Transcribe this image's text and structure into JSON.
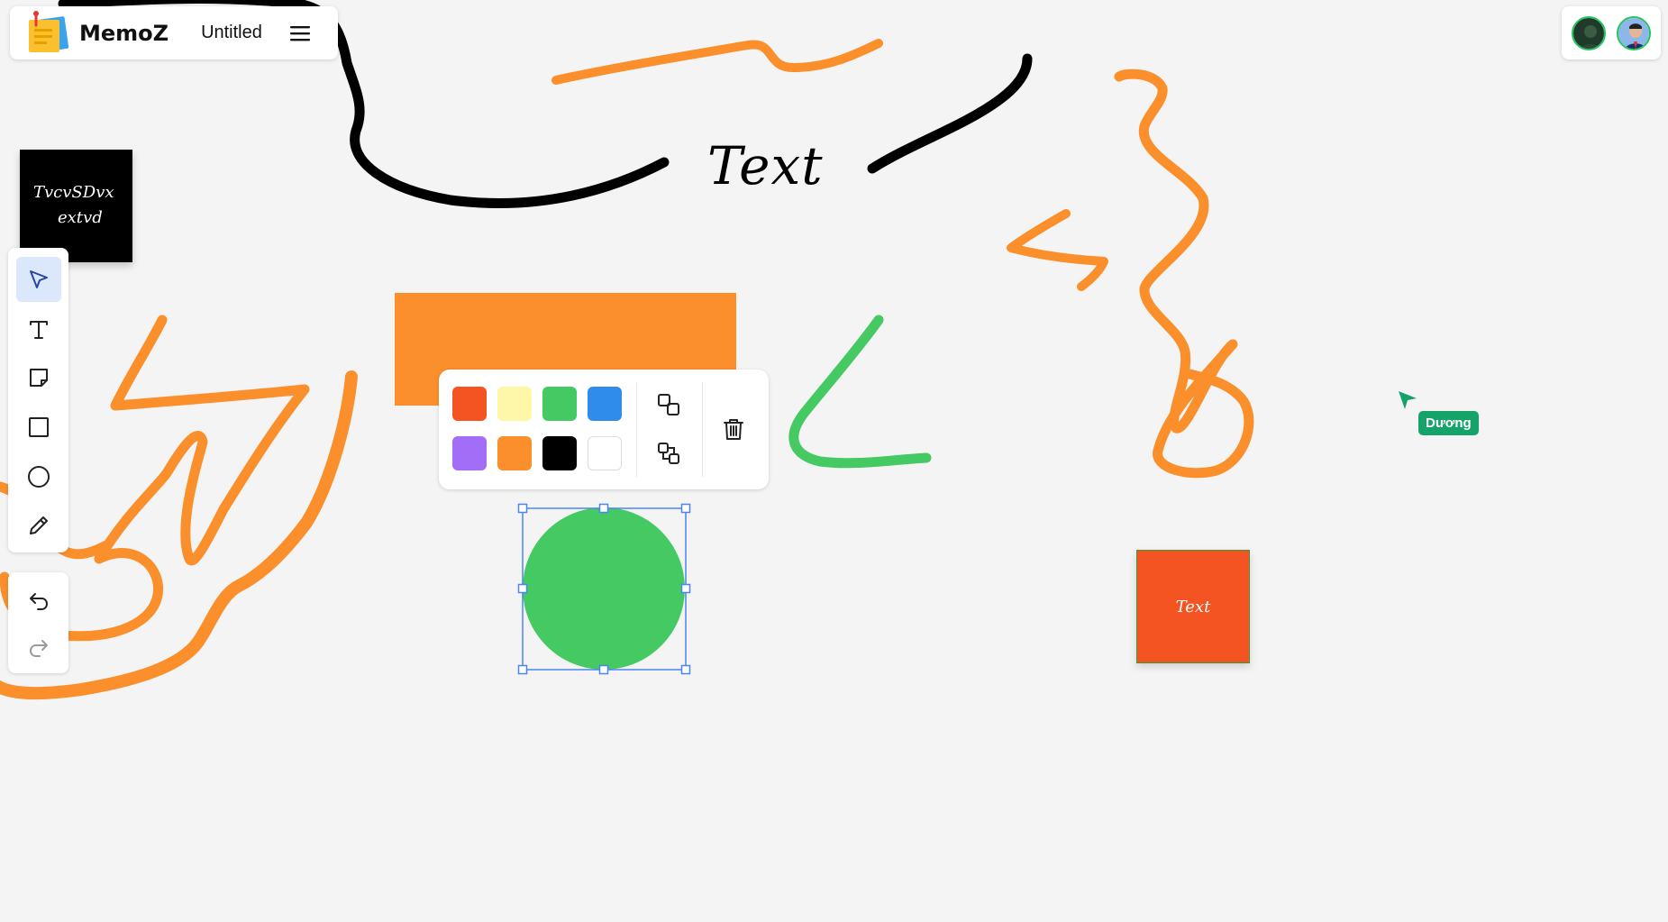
{
  "app": {
    "name": "MemoZ",
    "document_title": "Untitled"
  },
  "topbar": {
    "menu_icon": "hamburger-menu-icon",
    "logo_icon": "sticky-notes-logo"
  },
  "collaborators": [
    {
      "name": "collaborator-1",
      "ring": "#22c55e"
    },
    {
      "name": "collaborator-2",
      "ring": "#22c55e"
    }
  ],
  "canvas": {
    "background": "#f4f4f4",
    "text_element": "Text",
    "sticky_notes": [
      {
        "lines": [
          "TvcvSDvx",
          "extvd"
        ],
        "color": "#000000",
        "text_color": "#ffffff"
      },
      {
        "lines": [
          "Text"
        ],
        "color": "#f35422",
        "text_color": "#ffffff"
      }
    ],
    "shapes": [
      {
        "kind": "rectangle",
        "color": "#fb8f2b"
      },
      {
        "kind": "circle",
        "color": "#45c962",
        "selected": true
      }
    ],
    "stroke_colors": [
      "#000000",
      "#fb8f2b",
      "#45c962"
    ]
  },
  "toolbar": {
    "tools": [
      {
        "name": "select",
        "icon": "cursor-arrow-icon",
        "active": true
      },
      {
        "name": "text",
        "icon": "text-icon",
        "active": false
      },
      {
        "name": "sticky-note",
        "icon": "sticky-note-icon",
        "active": false
      },
      {
        "name": "rectangle",
        "icon": "rectangle-icon",
        "active": false
      },
      {
        "name": "ellipse",
        "icon": "circle-icon",
        "active": false
      },
      {
        "name": "pencil",
        "icon": "pencil-icon",
        "active": false
      }
    ],
    "history": [
      {
        "name": "undo",
        "icon": "undo-icon"
      },
      {
        "name": "redo",
        "icon": "redo-icon"
      }
    ]
  },
  "style_popup": {
    "colors": [
      "#f35422",
      "#fff7a8",
      "#45c962",
      "#2f8ceb",
      "#a36ef7",
      "#fb8f2b",
      "#000000",
      "#ffffff"
    ],
    "actions": [
      {
        "name": "bring-forward",
        "icon": "bring-to-front-icon"
      },
      {
        "name": "send-backward",
        "icon": "send-to-back-icon"
      },
      {
        "name": "delete",
        "icon": "trash-icon"
      }
    ]
  },
  "remote_cursor": {
    "label": "Dương",
    "color": "#16a36a"
  }
}
